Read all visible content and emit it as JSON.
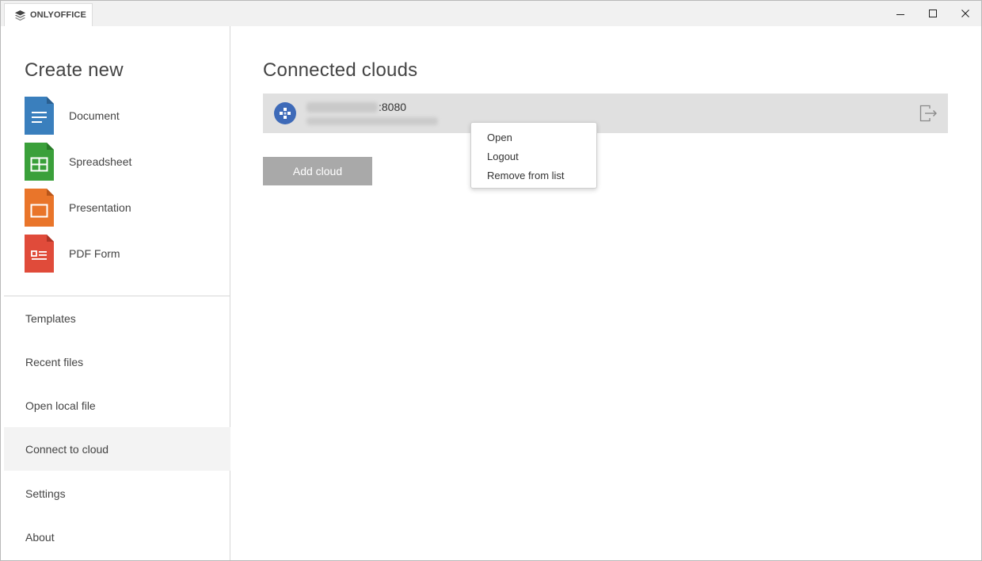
{
  "app": {
    "brand": "ONLYOFFICE"
  },
  "window_controls": {
    "minimize": "minimize-icon",
    "maximize": "maximize-icon",
    "close": "close-icon"
  },
  "sidebar": {
    "create_title": "Create new",
    "create_items": [
      {
        "label": "Document",
        "icon": "document-icon",
        "color": "#3a7fbd"
      },
      {
        "label": "Spreadsheet",
        "icon": "spreadsheet-icon",
        "color": "#3aa03a"
      },
      {
        "label": "Presentation",
        "icon": "presentation-icon",
        "color": "#e9752a"
      },
      {
        "label": "PDF Form",
        "icon": "pdf-form-icon",
        "color": "#e04b3a"
      }
    ],
    "nav_items": [
      {
        "label": "Templates"
      },
      {
        "label": "Recent files"
      },
      {
        "label": "Open local file"
      },
      {
        "label": "Connect to cloud",
        "active": true
      },
      {
        "label": "Settings"
      },
      {
        "label": "About"
      }
    ]
  },
  "main": {
    "title": "Connected clouds",
    "cloud": {
      "port": ":8080",
      "avatar_color": "#3e6ab8"
    },
    "add_cloud_label": "Add cloud"
  },
  "context_menu": {
    "items": [
      {
        "label": "Open"
      },
      {
        "label": "Logout"
      },
      {
        "label": "Remove from list"
      }
    ]
  }
}
